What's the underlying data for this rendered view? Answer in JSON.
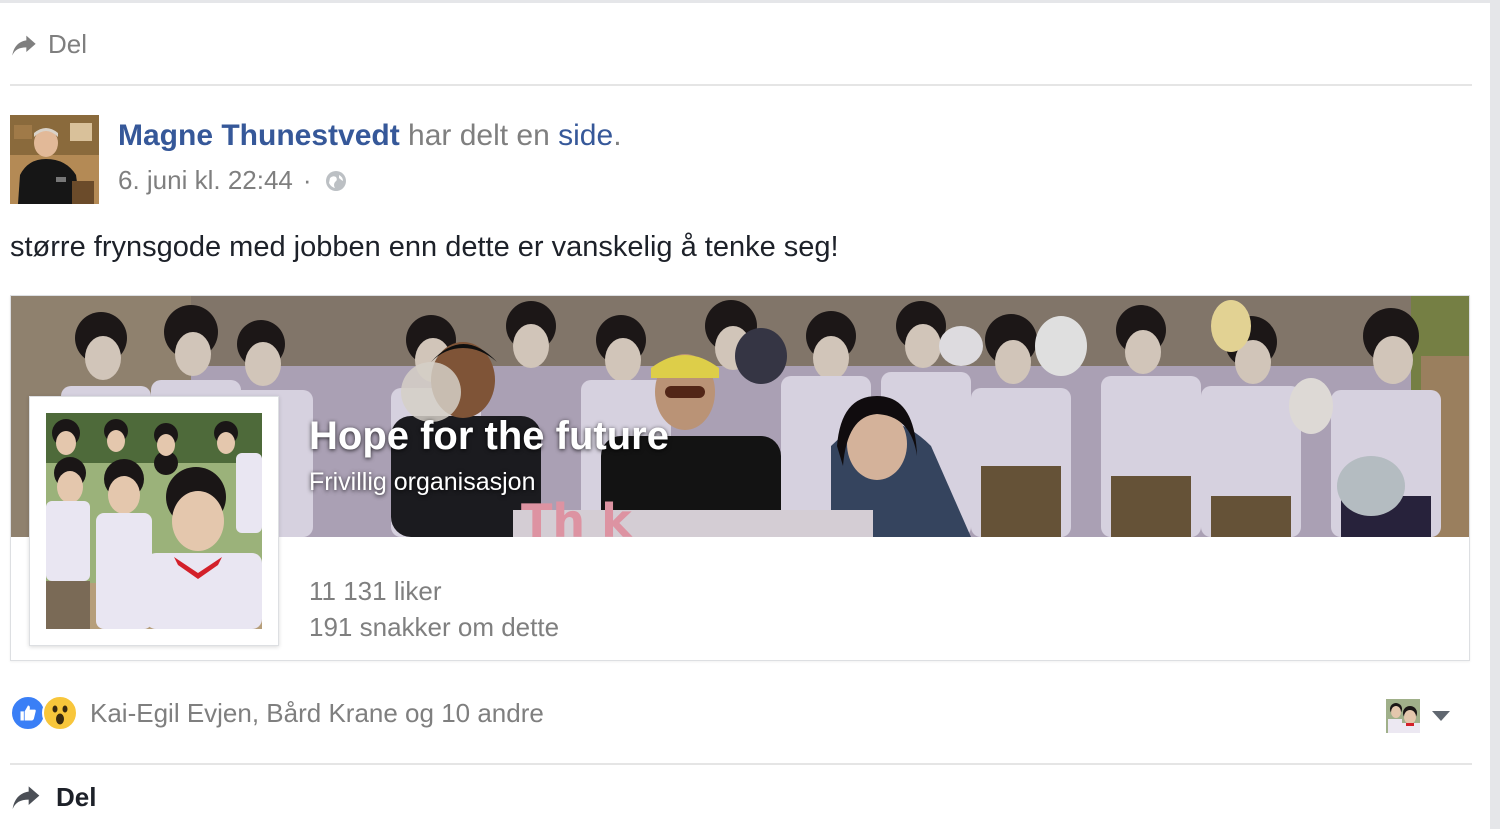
{
  "top_share": {
    "label": "Del",
    "icon": "share-arrow-icon"
  },
  "post": {
    "author": "Magne Thunestvedt",
    "action_text": " har delt en ",
    "object_link": "side",
    "period": ".",
    "timestamp": "6. juni kl. 22:44",
    "separator": "·",
    "privacy_icon": "globe-icon",
    "text": "større frynsgode med jobben enn dette er vanskelig å tenke seg!"
  },
  "shared_page": {
    "name": "Hope for the future",
    "category": "Frivillig organisasjon",
    "likes": "11 131 liker",
    "talking": "191 snakker om dette"
  },
  "reactions": {
    "icons": [
      "like-reaction-icon",
      "wow-reaction-icon"
    ],
    "names": "Kai-Egil Evjen, Bård Krane og 10 andre"
  },
  "bottom_share": {
    "label": "Del",
    "icon": "share-arrow-icon"
  },
  "colors": {
    "link_blue": "#365899",
    "muted_text": "#7f7f7f",
    "body_text": "#1d2129",
    "like_blue": "#3a7ff6",
    "wow_yellow": "#f8c63b"
  }
}
